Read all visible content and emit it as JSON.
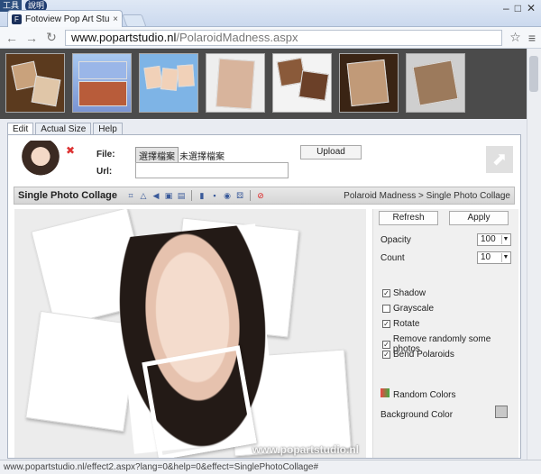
{
  "browser": {
    "menu": [
      "工具",
      "說明"
    ],
    "tab_title": "Fotoview Pop Art Studio",
    "tab_close": "×",
    "window_controls": [
      "–",
      "□",
      "✕"
    ],
    "nav": {
      "back": "←",
      "forward": "→",
      "reload": "↻"
    },
    "address_host": "www.popartstudio.nl",
    "address_path": "/PolaroidMadness.aspx",
    "star": "☆",
    "menu_icon": "≡"
  },
  "thumbnails": [
    "thumb-1",
    "thumb-2",
    "thumb-3",
    "thumb-4",
    "thumb-5",
    "thumb-6",
    "thumb-7"
  ],
  "page_tabs": [
    "Edit",
    "Actual Size",
    "Help"
  ],
  "upload": {
    "close": "✖",
    "file_label": "File:",
    "file_button": "選擇檔案",
    "file_status": "未選擇檔案",
    "url_label": "Url:",
    "url_value": "",
    "upload_button": "Upload"
  },
  "effectbar": {
    "title": "Single Photo Collage",
    "breadcrumb": "Polaroid Madness > Single Photo Collage"
  },
  "canvas": {
    "watermark": "www.popartstudio.nl"
  },
  "controls": {
    "refresh": "Refresh",
    "apply": "Apply",
    "opacity_label": "Opacity",
    "opacity_value": "100",
    "count_label": "Count",
    "count_value": "10",
    "checkboxes": [
      {
        "label": "Shadow",
        "checked": true
      },
      {
        "label": "Grayscale",
        "checked": false
      },
      {
        "label": "Rotate",
        "checked": true
      },
      {
        "label": "Remove randomly some photos",
        "checked": true
      },
      {
        "label": "Bend Polaroids",
        "checked": true
      }
    ],
    "random_colors": "Random Colors",
    "background_color_label": "Background Color",
    "background_color": "#c8c8c8"
  },
  "statusbar": "www.popartstudio.nl/effect2.aspx?lang=0&help=0&effect=SinglePhotoCollage#"
}
